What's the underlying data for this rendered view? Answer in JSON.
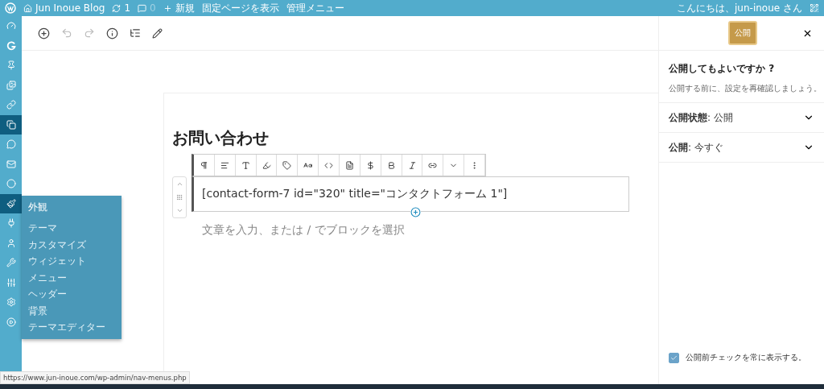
{
  "admin_bar": {
    "site": "Jun Inoue Blog",
    "updates": "1",
    "comments": "0",
    "new": "新規",
    "view": "固定ページを表示",
    "manage": "管理メニュー",
    "greeting": "こんにちは、jun-inoue さん"
  },
  "sidebar": {
    "items": [
      {
        "selected": false
      },
      {
        "selected": false
      },
      {
        "selected": false
      },
      {
        "selected": false
      },
      {
        "selected": false
      },
      {
        "selected": true
      },
      {
        "selected": false
      },
      {
        "selected": false
      },
      {
        "selected": false
      },
      {
        "selected": true
      },
      {
        "selected": false
      },
      {
        "selected": false
      },
      {
        "selected": false
      },
      {
        "selected": false
      },
      {
        "selected": false
      },
      {
        "selected": false
      }
    ],
    "flyout": {
      "title": "外観",
      "items": [
        "テーマ",
        "カスタマイズ",
        "ウィジェット",
        "メニュー",
        "ヘッダー",
        "背景",
        "テーマエディター"
      ]
    }
  },
  "editor": {
    "title": "お問い合わせ",
    "shortcode": "[contact-form-7 id=\"320\" title=\"コンタクトフォーム 1\"]",
    "placeholder": "文章を入力、または / でブロックを選択"
  },
  "publish_panel": {
    "button": "公開",
    "question": "公開してもよいですか ?",
    "hint": "公開する前に、設定を再確認しましょう。",
    "rows": [
      {
        "text": "**公開状態**: 公開",
        "expanded": false
      },
      {
        "text": "**公開**: 今すぐ",
        "expanded": false
      }
    ],
    "always_show": {
      "label": "公開前チェックを常に表示する。",
      "checked": true
    }
  },
  "status_url": "https://www.jun-inoue.com/wp-admin/nav-menus.php"
}
